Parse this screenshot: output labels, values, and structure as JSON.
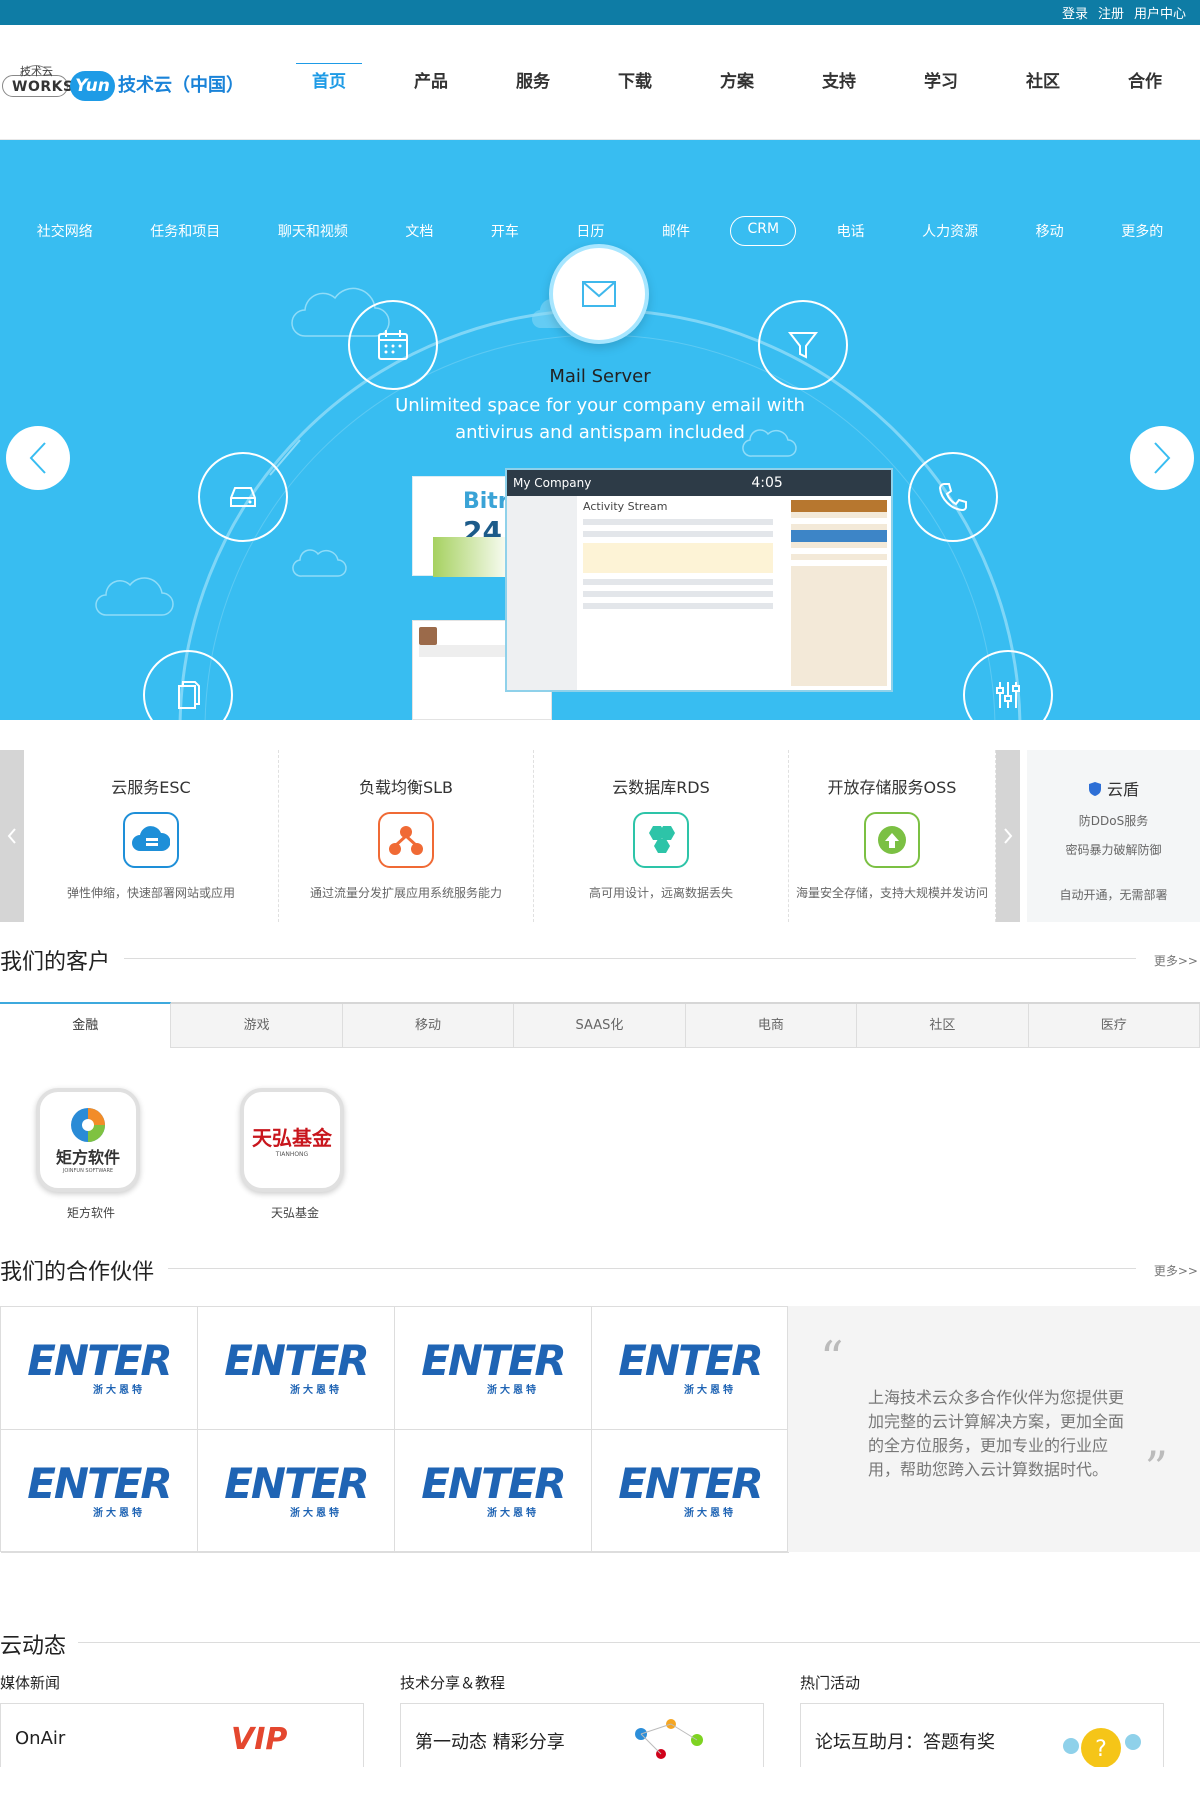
{
  "topbar": {
    "links": [
      "登录",
      "注册",
      "用户中心"
    ]
  },
  "header": {
    "logo_small": "技术云",
    "logo_works": "WORKS",
    "logo_yun": "Yun",
    "logo_name": "技术云（中国）",
    "nav": [
      "首页",
      "产品",
      "服务",
      "下载",
      "方案",
      "支持",
      "学习",
      "社区",
      "合作"
    ]
  },
  "hero": {
    "subnav": [
      "社交网络",
      "任务和项目",
      "聊天和视频",
      "文档",
      "开车",
      "日历",
      "邮件",
      "CRM",
      "电话",
      "人力资源",
      "移动",
      "更多的"
    ],
    "active_subnav": "CRM",
    "title": "Mail Server",
    "desc1": "Unlimited space for your company email with",
    "desc2": "antivirus and antispam included",
    "mock": {
      "company": "My Company",
      "time": "4:05",
      "stream": "Activity Stream",
      "box_brand": "Bitri",
      "box_num": "24"
    }
  },
  "services": {
    "items": [
      {
        "title": "云服务ESC",
        "desc": "弹性伸缩，快速部署网站或应用",
        "color": "#1e8fd8"
      },
      {
        "title": "负载均衡SLB",
        "desc": "通过流量分发扩展应用系统服务能力",
        "color": "#f06a35"
      },
      {
        "title": "云数据库RDS",
        "desc": "高可用设计，远离数据丢失",
        "color": "#2dc4a8"
      },
      {
        "title": "开放存储服务OSS",
        "desc": "海量安全存储，支持大规模并发访问",
        "color": "#7bc043"
      }
    ],
    "shield": {
      "title": "云盾",
      "line1": "防DDoS服务",
      "line2": "密码暴力破解防御",
      "line3": "自动开通，无需部署"
    }
  },
  "customers": {
    "title": "我们的客户",
    "more": "更多>>",
    "tabs": [
      "金融",
      "游戏",
      "移动",
      "SAAS化",
      "电商",
      "社区",
      "医疗"
    ],
    "active_tab": "金融",
    "clients": [
      {
        "name": "矩方软件",
        "logo_text": "矩方软件",
        "logo_sub": "JOINFUN SOFTWARE"
      },
      {
        "name": "天弘基金",
        "logo_text": "天弘基金",
        "logo_sub": "TIANHONG"
      }
    ]
  },
  "partners": {
    "title": "我们的合作伙伴",
    "more": "更多>>",
    "logo_text": "ENTER",
    "logo_sub": "浙大恩特",
    "quote": "上海技术云众多合作伙伴为您提供更加完整的云计算解决方案，更加全面的全方位服务，更加专业的行业应用，帮助您跨入云计算数据时代。"
  },
  "news": {
    "title": "云动态",
    "cols": [
      {
        "title": "媒体新闻",
        "card": "OnAir",
        "tag": "VIP"
      },
      {
        "title": "技术分享＆教程",
        "card": "第一动态 精彩分享",
        "tag": ""
      },
      {
        "title": "热门活动",
        "card": "论坛互助月：答题有奖",
        "tag": ""
      }
    ]
  }
}
